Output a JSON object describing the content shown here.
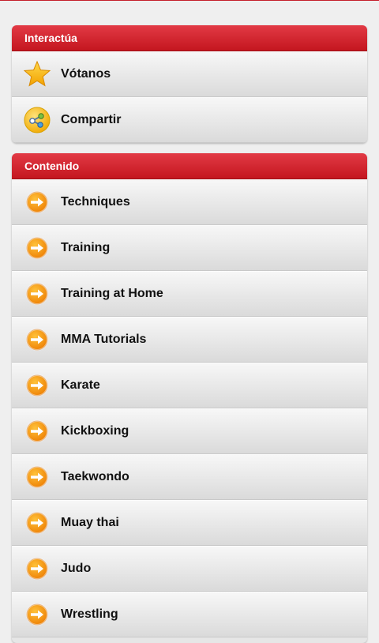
{
  "interact": {
    "header": "Interactúa",
    "items": [
      {
        "label": "Vótanos",
        "icon": "star-icon"
      },
      {
        "label": "Compartir",
        "icon": "share-icon"
      }
    ]
  },
  "content": {
    "header": "Contenido",
    "items": [
      {
        "label": "Techniques",
        "icon": "arrow-right-icon"
      },
      {
        "label": "Training",
        "icon": "arrow-right-icon"
      },
      {
        "label": "Training at Home",
        "icon": "arrow-right-icon"
      },
      {
        "label": "MMA Tutorials",
        "icon": "arrow-right-icon"
      },
      {
        "label": "Karate",
        "icon": "arrow-right-icon"
      },
      {
        "label": "Kickboxing",
        "icon": "arrow-right-icon"
      },
      {
        "label": "Taekwondo",
        "icon": "arrow-right-icon"
      },
      {
        "label": "Muay thai",
        "icon": "arrow-right-icon"
      },
      {
        "label": "Judo",
        "icon": "arrow-right-icon"
      },
      {
        "label": "Wrestling",
        "icon": "arrow-right-icon"
      }
    ]
  },
  "colors": {
    "header_red": "#c4161f",
    "icon_orange": "#f08a00"
  }
}
